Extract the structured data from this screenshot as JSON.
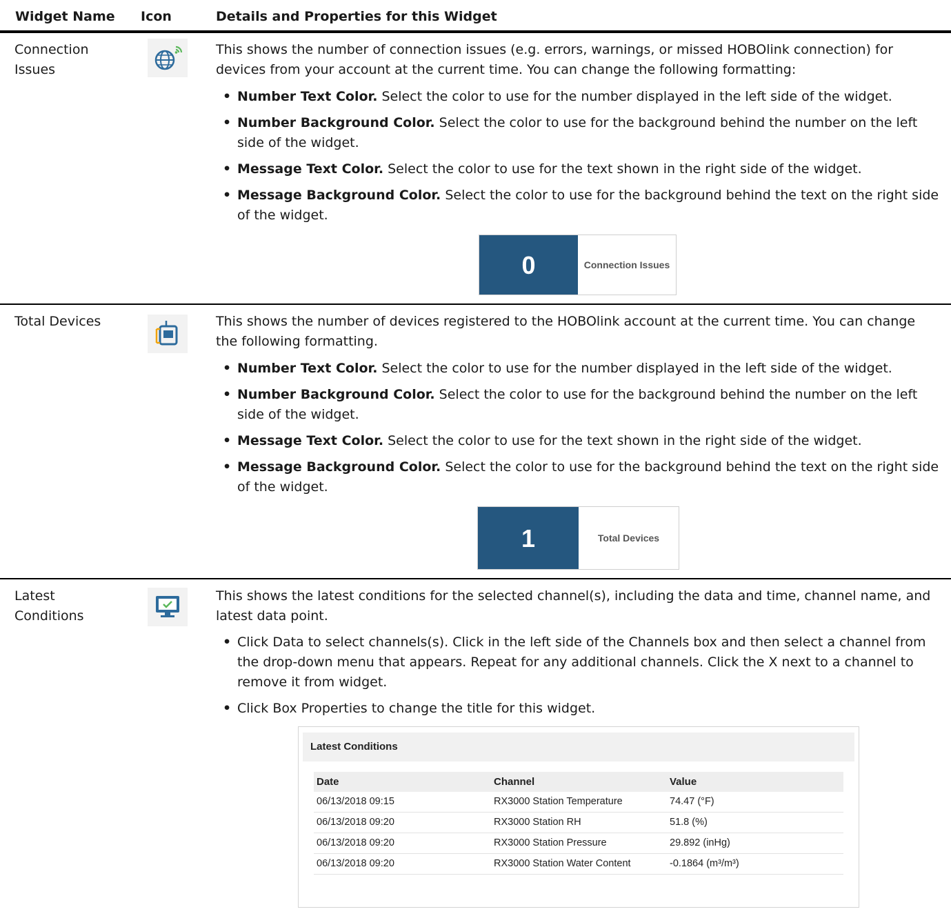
{
  "header": {
    "col_name": "Widget Name",
    "col_icon": "Icon",
    "col_details": "Details and Properties for this Widget"
  },
  "connection_issues": {
    "name": "Connection Issues",
    "icon": "globe-signal-icon",
    "intro": "This shows the number of connection issues (e.g. errors, warnings, or missed HOBOlink connection) for devices from your account at the current time. You can change the following formatting:",
    "props": [
      {
        "label": "Number Text Color.",
        "text": " Select the color to use for the number displayed in the left side of the widget."
      },
      {
        "label": "Number Background Color.",
        "text": " Select the color to use for the background behind the number on the left side of the widget."
      },
      {
        "label": "Message Text Color.",
        "text": " Select the color to use for the text shown in the right side of the widget."
      },
      {
        "label": "Message Background Color.",
        "text": " Select the color to use for the background behind the text on the right side of the widget."
      }
    ],
    "widget": {
      "number": "0",
      "message": "Connection Issues"
    }
  },
  "total_devices": {
    "name": "Total Devices",
    "icon": "device-icon",
    "intro": "This shows the number of devices registered to the HOBOlink account at the current time. You can change the following formatting.",
    "props": [
      {
        "label": "Number Text Color.",
        "text": " Select the color to use for the number displayed in the left side of the widget."
      },
      {
        "label": "Number Background Color.",
        "text": " Select the color to use for the background behind the number on the left side of the widget."
      },
      {
        "label": "Message Text Color.",
        "text": " Select the color to use for the text shown in the right side of the widget."
      },
      {
        "label": "Message Background Color.",
        "text": " Select the color to use for the background behind the text on the right side of the widget."
      }
    ],
    "widget": {
      "number": "1",
      "message": "Total Devices"
    }
  },
  "latest_conditions": {
    "name": "Latest Conditions",
    "icon": "monitor-check-icon",
    "intro": "This shows the latest conditions for the selected channel(s), including the data and time, channel name, and latest data point.",
    "props": [
      "Click Data to select channels(s). Click in the left side of the Channels box and then select a channel from the drop-down menu that appears. Repeat for any additional channels. Click the X next to a channel to remove it from widget.",
      "Click Box Properties to change the title for this widget."
    ],
    "widget": {
      "title": "Latest Conditions",
      "columns": [
        "Date",
        "Channel",
        "Value"
      ],
      "rows": [
        [
          "06/13/2018 09:15",
          "RX3000 Station Temperature",
          "74.47 (°F)"
        ],
        [
          "06/13/2018 09:20",
          "RX3000 Station RH",
          "51.8 (%)"
        ],
        [
          "06/13/2018 09:20",
          "RX3000 Station Pressure",
          "29.892 (inHg)"
        ],
        [
          "06/13/2018 09:20",
          "RX3000 Station Water Content",
          "-0.1864 (m³/m³)"
        ]
      ]
    }
  },
  "colors": {
    "widget_blue": "#25577f",
    "icon_blue": "#2d6b9c",
    "icon_green": "#5cb85c",
    "icon_orange": "#f0a30a"
  }
}
